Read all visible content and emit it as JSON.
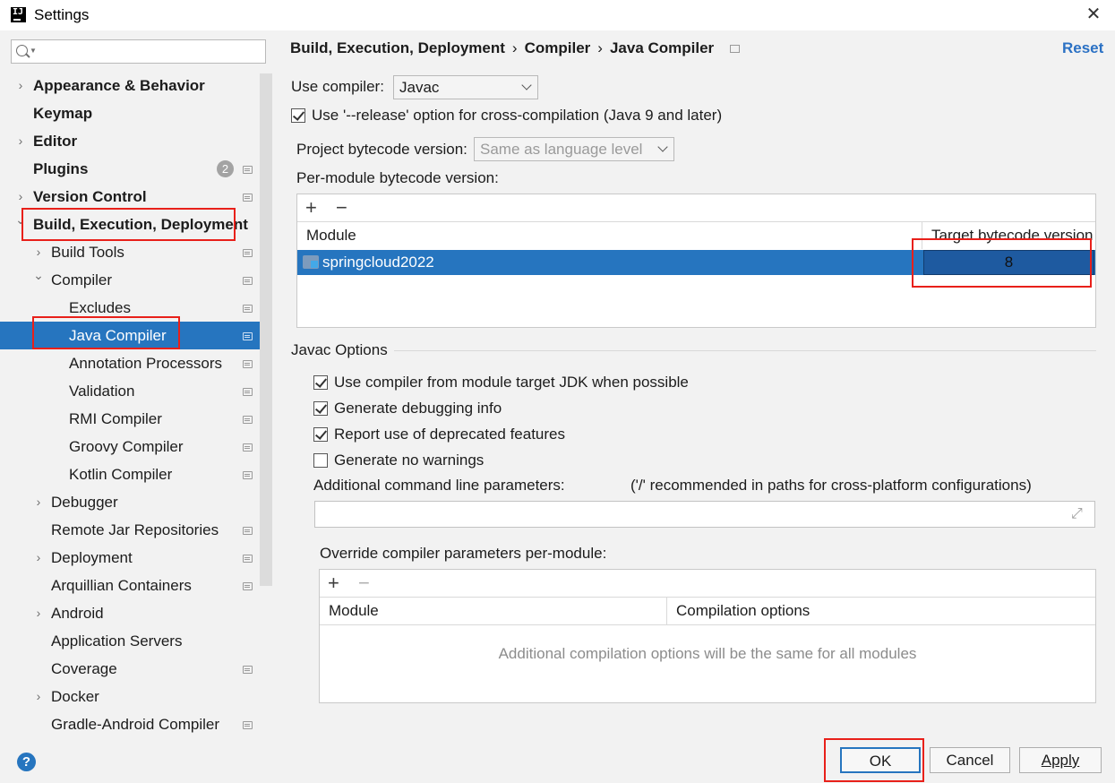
{
  "window": {
    "title": "Settings",
    "icon_text": "IJ"
  },
  "search": {
    "placeholder": ""
  },
  "sidebar": {
    "items": [
      {
        "label": "Appearance & Behavior",
        "bold": true,
        "chevron": "right"
      },
      {
        "label": "Keymap",
        "bold": true
      },
      {
        "label": "Editor",
        "bold": true,
        "chevron": "right"
      },
      {
        "label": "Plugins",
        "bold": true,
        "badge": "2"
      },
      {
        "label": "Version Control",
        "bold": true,
        "chevron": "right"
      },
      {
        "label": "Build, Execution, Deployment",
        "bold": true,
        "chevron": "down"
      },
      {
        "label": "Build Tools",
        "chevron": "right"
      },
      {
        "label": "Compiler",
        "chevron": "down"
      },
      {
        "label": "Excludes"
      },
      {
        "label": "Java Compiler",
        "selected": true
      },
      {
        "label": "Annotation Processors"
      },
      {
        "label": "Validation"
      },
      {
        "label": "RMI Compiler"
      },
      {
        "label": "Groovy Compiler"
      },
      {
        "label": "Kotlin Compiler"
      },
      {
        "label": "Debugger",
        "chevron": "right"
      },
      {
        "label": "Remote Jar Repositories"
      },
      {
        "label": "Deployment",
        "chevron": "right"
      },
      {
        "label": "Arquillian Containers"
      },
      {
        "label": "Android",
        "chevron": "right"
      },
      {
        "label": "Application Servers"
      },
      {
        "label": "Coverage"
      },
      {
        "label": "Docker",
        "chevron": "right"
      },
      {
        "label": "Gradle-Android Compiler"
      }
    ]
  },
  "breadcrumb": {
    "part1": "Build, Execution, Deployment",
    "part2": "Compiler",
    "part3": "Java Compiler",
    "sep": "›"
  },
  "reset_label": "Reset",
  "compiler": {
    "use_compiler_label": "Use compiler:",
    "use_compiler_value": "Javac",
    "release_option_label": "Use '--release' option for cross-compilation (Java 9 and later)",
    "release_option_checked": true,
    "project_bytecode_label": "Project bytecode version:",
    "project_bytecode_value": "Same as language level",
    "per_module_label": "Per-module bytecode version:"
  },
  "module_table": {
    "add": "+",
    "remove": "−",
    "col_module": "Module",
    "col_target": "Target bytecode version",
    "rows": [
      {
        "module": "springcloud2022",
        "target": "8"
      }
    ]
  },
  "javac": {
    "section_title": "Javac Options",
    "options": [
      {
        "label": "Use compiler from module target JDK when possible",
        "checked": true
      },
      {
        "label": "Generate debugging info",
        "checked": true
      },
      {
        "label": "Report use of deprecated features",
        "checked": true
      },
      {
        "label": "Generate no warnings",
        "checked": false
      }
    ],
    "additional_params_label": "Additional command line parameters:",
    "additional_params_hint": "('/' recommended in paths for cross-platform configurations)",
    "additional_params_value": "",
    "override_label": "Override compiler parameters per-module:"
  },
  "override_table": {
    "add": "+",
    "remove": "−",
    "col_module": "Module",
    "col_options": "Compilation options",
    "empty_text": "Additional compilation options will be the same for all modules"
  },
  "footer": {
    "help": "?",
    "ok": "OK",
    "cancel": "Cancel",
    "apply": "Apply"
  },
  "colors": {
    "selection": "#2675bf",
    "link": "#2b71c4",
    "annotation": "#e8201a"
  }
}
